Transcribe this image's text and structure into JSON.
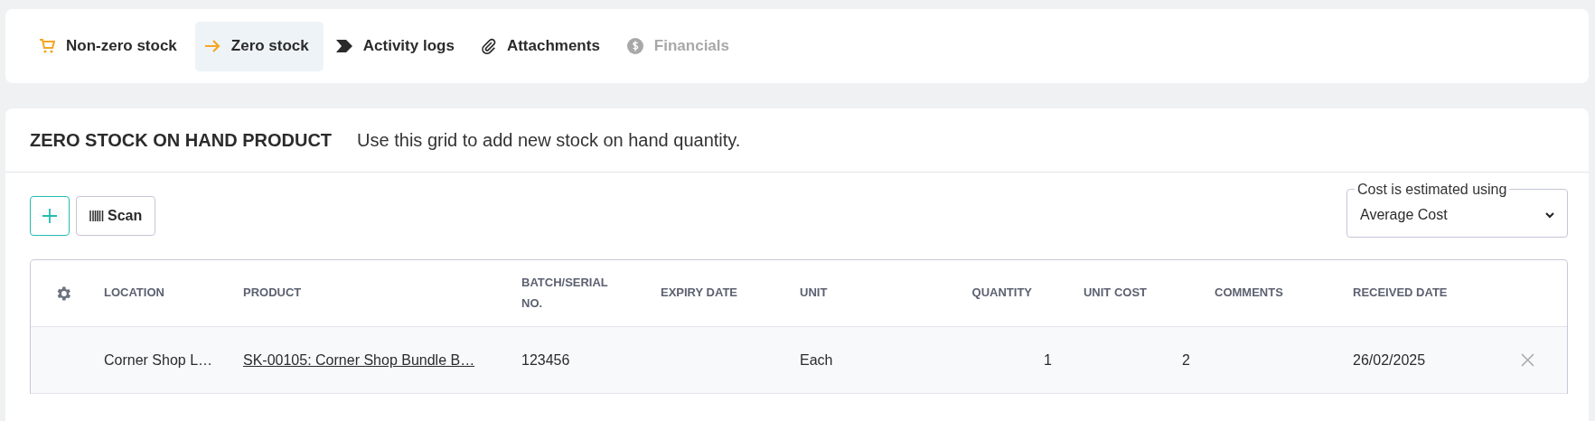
{
  "tabs": [
    {
      "label": "Non-zero stock",
      "kind": "cart",
      "selected": false,
      "disabled": false
    },
    {
      "label": "Zero stock",
      "kind": "arrow",
      "selected": true,
      "disabled": false
    },
    {
      "label": "Activity logs",
      "kind": "chevron",
      "selected": false,
      "disabled": false
    },
    {
      "label": "Attachments",
      "kind": "clip",
      "selected": false,
      "disabled": false
    },
    {
      "label": "Financials",
      "kind": "dollar",
      "selected": false,
      "disabled": true
    }
  ],
  "panel": {
    "title": "ZERO STOCK ON HAND PRODUCT",
    "description": "Use this grid to add new stock on hand quantity."
  },
  "toolbar": {
    "scan_label": "Scan",
    "cost_select": {
      "label": "Cost is estimated using",
      "value": "Average Cost"
    }
  },
  "table": {
    "columns": [
      "LOCATION",
      "PRODUCT",
      "BATCH/SERIAL NO.",
      "EXPIRY DATE",
      "UNIT",
      "QUANTITY",
      "UNIT COST",
      "COMMENTS",
      "RECEIVED DATE"
    ],
    "rows": [
      {
        "location": "Corner Shop L…",
        "product": "SK-00105: Corner Shop Bundle B…",
        "batch": "123456",
        "expiry": "",
        "unit": "Each",
        "quantity": "1",
        "unit_cost": "2",
        "comments": "",
        "received": "26/02/2025"
      }
    ]
  }
}
